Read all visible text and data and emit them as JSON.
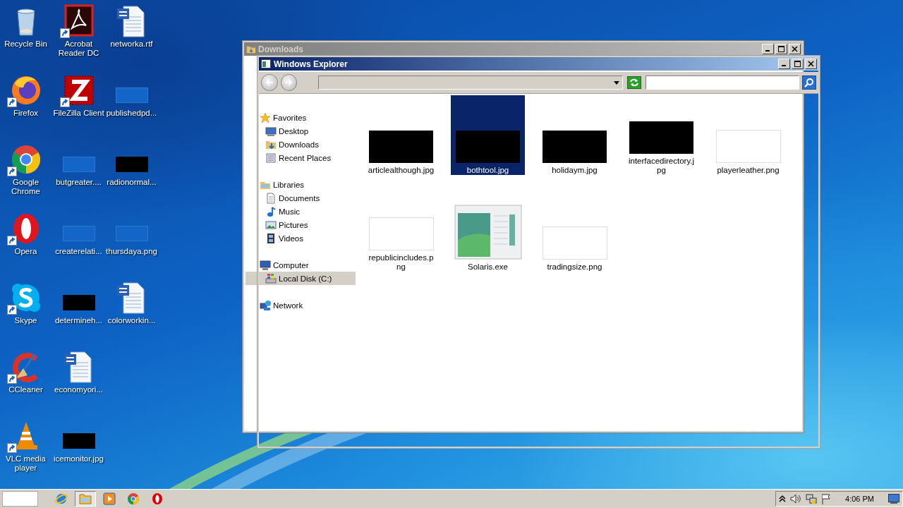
{
  "desktop": {
    "icons": [
      {
        "label": "Recycle Bin",
        "kind": "recycle",
        "shortcut": false
      },
      {
        "label": "Firefox",
        "kind": "firefox",
        "shortcut": true
      },
      {
        "label": "Google Chrome",
        "kind": "chrome",
        "shortcut": true
      },
      {
        "label": "Opera",
        "kind": "opera",
        "shortcut": true
      },
      {
        "label": "Skype",
        "kind": "skype",
        "shortcut": true
      },
      {
        "label": "CCleaner",
        "kind": "ccleaner",
        "shortcut": true
      },
      {
        "label": "VLC media player",
        "kind": "vlc",
        "shortcut": true
      },
      {
        "label": "Acrobat Reader DC",
        "kind": "pdf",
        "shortcut": true
      },
      {
        "label": "FileZilla Client",
        "kind": "filezilla",
        "shortcut": true
      },
      {
        "label": "butgreater....",
        "kind": "blank",
        "shortcut": false
      },
      {
        "label": "createrelati...",
        "kind": "blank",
        "shortcut": false
      },
      {
        "label": "determineh...",
        "kind": "dark",
        "shortcut": false
      },
      {
        "label": "economyori...",
        "kind": "word",
        "shortcut": false
      },
      {
        "label": "icemonitor.jpg",
        "kind": "dark",
        "shortcut": false
      },
      {
        "label": "networka.rtf",
        "kind": "word",
        "shortcut": false
      },
      {
        "label": "publishedpd...",
        "kind": "blank",
        "shortcut": false
      },
      {
        "label": "radionormal...",
        "kind": "dark",
        "shortcut": false
      },
      {
        "label": "thursdaya.png",
        "kind": "blank",
        "shortcut": false
      },
      {
        "label": "colorworkin...",
        "kind": "word",
        "shortcut": false
      }
    ]
  },
  "windows": [
    {
      "title": "Downloads",
      "active": false,
      "nav": [
        {
          "label": "Favorites",
          "kind": "star",
          "selected": false,
          "children": [
            {
              "label": "Desktop",
              "kind": "desktop",
              "selected": false
            },
            {
              "label": "Downloads",
              "kind": "downloads",
              "selected": false
            },
            {
              "label": "Recent Places",
              "kind": "recent",
              "selected": false
            }
          ]
        },
        {
          "label": "Libraries",
          "kind": "library",
          "selected": false,
          "children": [
            {
              "label": "Documents",
              "kind": "doc",
              "selected": false
            },
            {
              "label": "Music",
              "kind": "music",
              "selected": false
            },
            {
              "label": "Pictures",
              "kind": "pictures",
              "selected": false
            },
            {
              "label": "Videos",
              "kind": "videos",
              "selected": false
            }
          ]
        },
        {
          "label": "Computer",
          "kind": "computer",
          "selected": false,
          "children": [
            {
              "label": "Local Disk (C:)",
              "kind": "disk",
              "selected": true
            }
          ]
        },
        {
          "label": "Network",
          "kind": "network",
          "selected": false
        }
      ],
      "files": [
        {
          "name": "articlealthough.jpg",
          "kind": "dark",
          "selected": false
        },
        {
          "name": "bothtool.jpg",
          "kind": "dark",
          "selected": true
        },
        {
          "name": "holidaym.jpg",
          "kind": "dark",
          "selected": false
        },
        {
          "name": "interfacedirectory.jpg",
          "kind": "dark",
          "selected": false
        },
        {
          "name": "playerleather.png",
          "kind": "white",
          "selected": false
        },
        {
          "name": "republicincludes.png",
          "kind": "white",
          "selected": false
        },
        {
          "name": "Solaris.exe",
          "kind": "app",
          "selected": false
        },
        {
          "name": "tradingsize.png",
          "kind": "white",
          "selected": false
        }
      ]
    },
    {
      "title": "Windows Explorer",
      "active": true
    }
  ],
  "taskbar": {
    "buttons": [
      {
        "kind": "ie",
        "selected": false
      },
      {
        "kind": "folder",
        "selected": true
      },
      {
        "kind": "media",
        "selected": false
      },
      {
        "kind": "chrome",
        "selected": false
      },
      {
        "kind": "opera",
        "selected": false
      }
    ],
    "clock": "4:06 PM"
  }
}
